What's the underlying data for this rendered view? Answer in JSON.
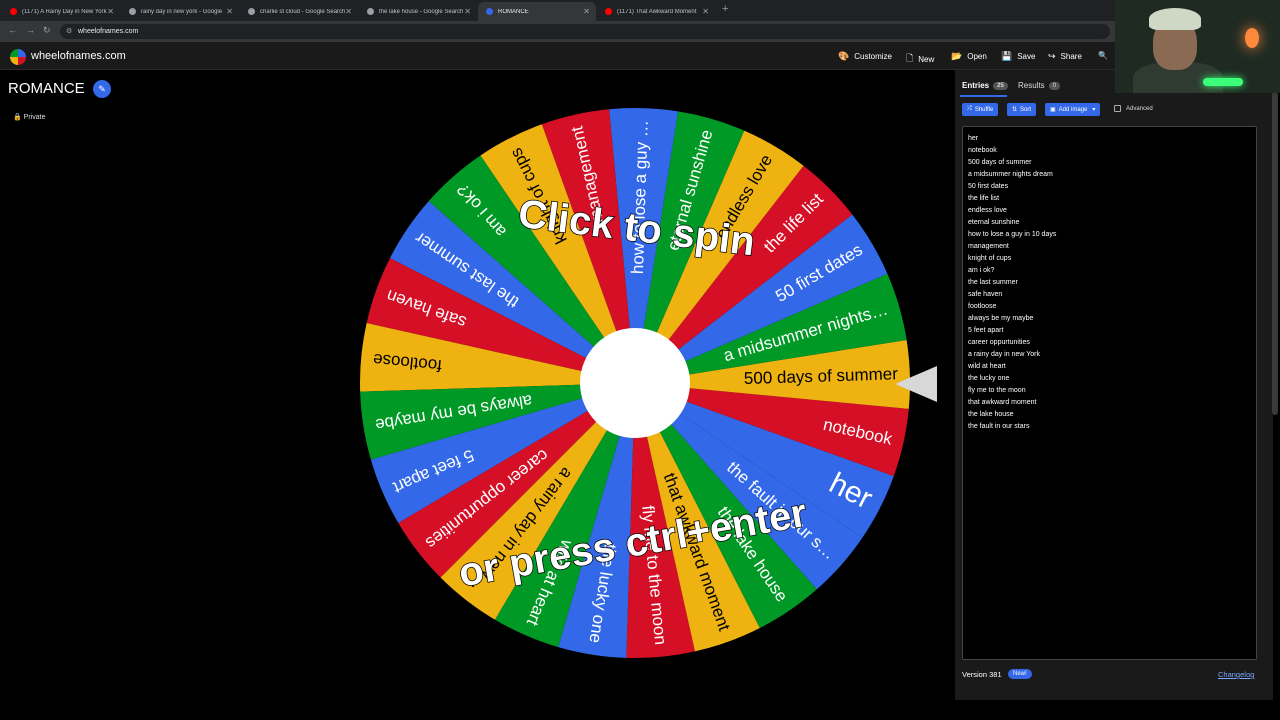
{
  "browser": {
    "tabs": [
      {
        "title": "(1171) A Rainy Day in New York",
        "favicon_color": "#ff0000",
        "active": false
      },
      {
        "title": "rainy day in new york - Google",
        "favicon_color": "#9aa0a6",
        "active": false
      },
      {
        "title": "charlie st cloud - Google Search",
        "favicon_color": "#9aa0a6",
        "active": false
      },
      {
        "title": "the lake house - Google Search",
        "favicon_color": "#9aa0a6",
        "active": false
      },
      {
        "title": "ROMANCE",
        "favicon_color": "#3369e8",
        "active": true
      },
      {
        "title": "(1171) That Awkward Moment",
        "favicon_color": "#ff0000",
        "active": false
      }
    ],
    "new_tab_icon": "plus-icon",
    "url": "wheelofnames.com"
  },
  "site": {
    "name": "wheelofnames.com",
    "menu": [
      {
        "label": "Customize",
        "icon": "palette-icon",
        "glyph": "🎨"
      },
      {
        "label": "New",
        "icon": "file-icon",
        "glyph": "🗋"
      },
      {
        "label": "Open",
        "icon": "folder-icon",
        "glyph": "📂"
      },
      {
        "label": "Save",
        "icon": "save-icon",
        "glyph": "💾"
      },
      {
        "label": "Share",
        "icon": "share-icon",
        "glyph": "↪"
      }
    ],
    "search_icon": "search-icon"
  },
  "wheel_title": "ROMANCE",
  "private_label": "Private",
  "wheel": {
    "overlay_top": "Click to spin",
    "overlay_bottom": "or press ctrl+enter",
    "colors": [
      "#3369e8",
      "#d50f25",
      "#eeb211",
      "#009925"
    ]
  },
  "panel": {
    "tabs": [
      {
        "label": "Entries",
        "count": "25"
      },
      {
        "label": "Results",
        "count": "0"
      }
    ],
    "buttons": {
      "shuffle": "Shuffle",
      "sort": "Sort",
      "add_image": "Add image",
      "advanced": "Advanced"
    },
    "entries": [
      "her",
      "notebook",
      "500 days of summer",
      "a midsummer nights dream",
      "50 first dates",
      "the life list",
      "endless love",
      "eternal sunshine",
      "how to lose a guy in 10 days",
      "management",
      "knight of cups",
      "am i ok?",
      "the last summer",
      "safe haven",
      "footloose",
      "always be my maybe",
      "5 feet apart",
      "career oppurtunities",
      "a rainy day in new York",
      "wild at heart",
      "the lucky one",
      "fly me to the moon",
      "that awkward moment",
      "the lake house",
      "the fault in our stars"
    ],
    "version": "Version 381",
    "new_badge": "New!",
    "changelog": "Changelog"
  }
}
